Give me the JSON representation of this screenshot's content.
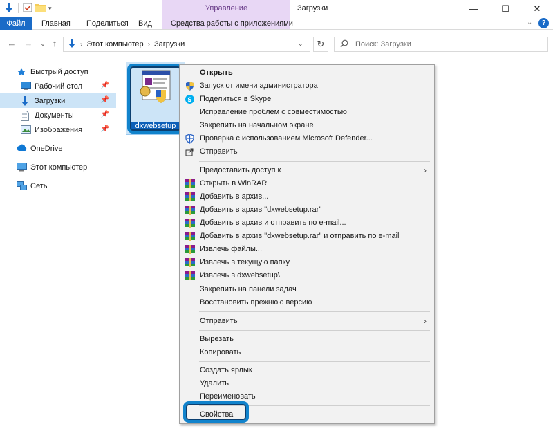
{
  "window": {
    "title": "Загрузки",
    "contextual_tab_group": "Управление",
    "minimize": "—",
    "maximize": "☐",
    "close": "✕"
  },
  "ribbon": {
    "tabs": [
      "Файл",
      "Главная",
      "Поделиться",
      "Вид",
      "Средства работы с приложениями"
    ],
    "expand_glyph": "⌄",
    "help_glyph": "?"
  },
  "address": {
    "crumbs": [
      "Этот компьютер",
      "Загрузки"
    ],
    "search_placeholder": "Поиск: Загрузки"
  },
  "sidebar": {
    "items": [
      {
        "label": "Быстрый доступ",
        "icon": "star-icon"
      },
      {
        "label": "Рабочий стол",
        "icon": "desktop-icon",
        "pinned": true
      },
      {
        "label": "Загрузки",
        "icon": "download-arrow-icon",
        "pinned": true,
        "selected": true
      },
      {
        "label": "Документы",
        "icon": "document-icon",
        "pinned": true
      },
      {
        "label": "Изображения",
        "icon": "pictures-icon",
        "pinned": true
      },
      {
        "label": "OneDrive",
        "icon": "cloud-icon"
      },
      {
        "label": "Этот компьютер",
        "icon": "computer-icon"
      },
      {
        "label": "Сеть",
        "icon": "network-icon"
      }
    ]
  },
  "file": {
    "name": "dxwebsetup"
  },
  "context_menu": {
    "items": [
      {
        "label": "Открыть",
        "bold": true
      },
      {
        "label": "Запуск от имени администратора",
        "icon": "uac-shield-icon"
      },
      {
        "label": "Поделиться в Skype",
        "icon": "skype-icon"
      },
      {
        "label": "Исправление проблем с совместимостью"
      },
      {
        "label": "Закрепить на начальном экране"
      },
      {
        "label": "Проверка с использованием Microsoft Defender...",
        "icon": "defender-icon"
      },
      {
        "label": "Отправить",
        "icon": "share-icon"
      },
      {
        "label": "Предоставить доступ к",
        "submenu": true
      },
      {
        "label": "Открыть в WinRAR",
        "icon": "winrar-icon"
      },
      {
        "label": "Добавить в архив...",
        "icon": "winrar-icon"
      },
      {
        "label": "Добавить в архив \"dxwebsetup.rar\"",
        "icon": "winrar-icon"
      },
      {
        "label": "Добавить в архив и отправить по e-mail...",
        "icon": "winrar-icon"
      },
      {
        "label": "Добавить в архив \"dxwebsetup.rar\" и отправить по e-mail",
        "icon": "winrar-icon"
      },
      {
        "label": "Извлечь файлы...",
        "icon": "winrar-icon"
      },
      {
        "label": "Извлечь в текущую папку",
        "icon": "winrar-icon"
      },
      {
        "label": "Извлечь в dxwebsetup\\",
        "icon": "winrar-icon"
      },
      {
        "label": "Закрепить на панели задач"
      },
      {
        "label": "Восстановить прежнюю версию"
      },
      {
        "label": "Отправить",
        "submenu": true
      },
      {
        "label": "Вырезать"
      },
      {
        "label": "Копировать"
      },
      {
        "label": "Создать ярлык"
      },
      {
        "label": "Удалить"
      },
      {
        "label": "Переименовать"
      },
      {
        "label": "Свойства"
      }
    ],
    "submenu_glyph": "›"
  },
  "colors": {
    "accent": "#1a6bc7",
    "selection": "#cce4f7",
    "highlight_frame": "#1183cc",
    "contextual_tab": "#e8d7f5"
  }
}
